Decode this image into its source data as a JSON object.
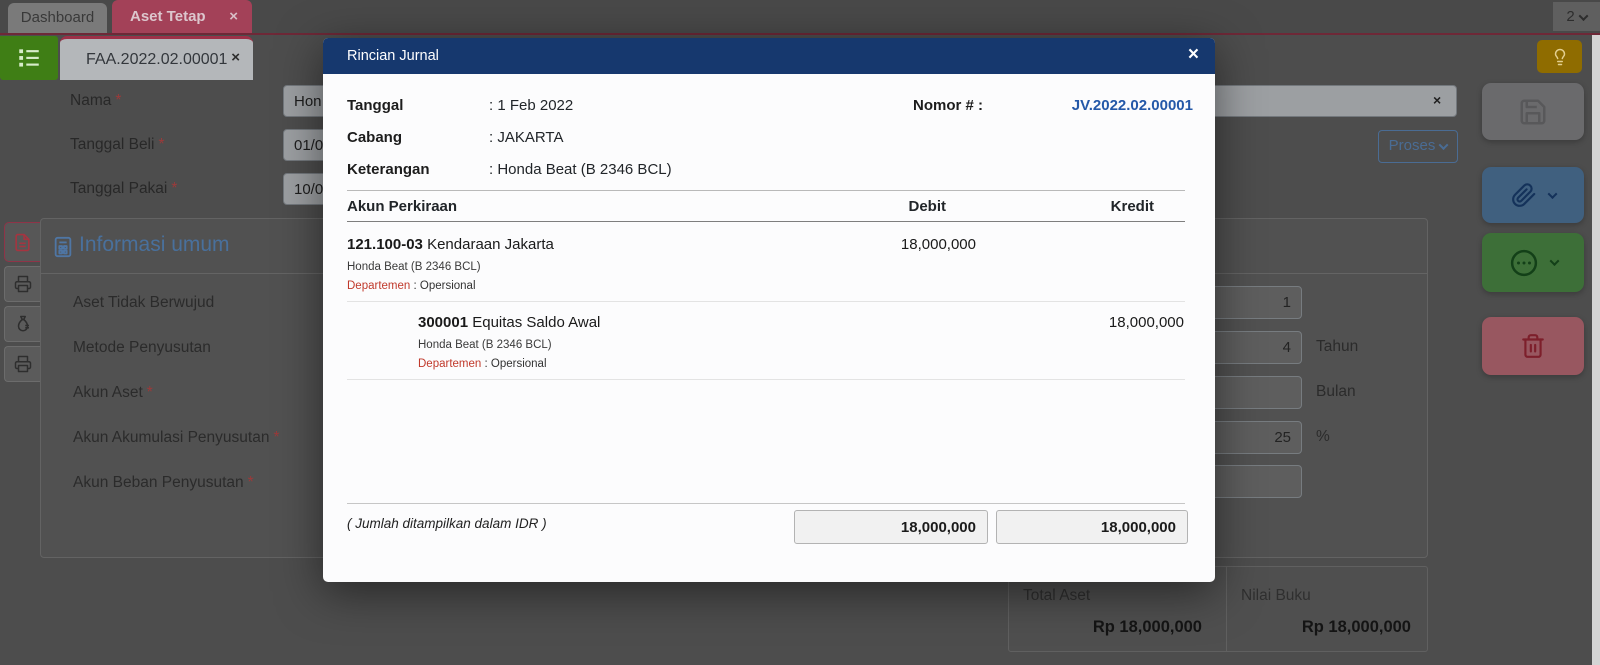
{
  "colors": {
    "modal_header_blue": "#16386E",
    "link_blue": "#2458A8",
    "departemen_red": "#C0392B",
    "active_tab_red": "#A34158",
    "menu_green": "#3F7E15",
    "hint_amber": "#8F6C00"
  },
  "top_bar": {
    "dashboard_tab": "Dashboard",
    "aset_tetap_tab": "Aset Tetap",
    "close_glyph": "×",
    "more_tabs_count": "2"
  },
  "doc_tab": {
    "label": "FAA.2022.02.00001",
    "close_glyph": "×"
  },
  "form": {
    "required_mark": "*",
    "rows": [
      {
        "label": "Nama",
        "value": "Hon"
      },
      {
        "label": "Tanggal Beli",
        "value": "01/0"
      },
      {
        "label": "Tanggal Pakai",
        "value": "10/0"
      }
    ],
    "clear_glyph": "×",
    "proses_button": "Proses",
    "panel": {
      "title": "Informasi umum",
      "fields": [
        {
          "label": "Aset Tidak Berwujud",
          "required": ""
        },
        {
          "label": "Metode Penyusutan",
          "required": ""
        },
        {
          "label": "Akun Aset",
          "required": "*"
        },
        {
          "label": "Akun Akumulasi Penyusutan",
          "required": "*"
        },
        {
          "label": "Akun Beban Penyusutan",
          "required": "*"
        }
      ],
      "right_inputs": [
        {
          "value": "1",
          "unit": ""
        },
        {
          "value": "4",
          "unit": "Tahun"
        },
        {
          "value": "",
          "unit": "Bulan"
        },
        {
          "value": "25",
          "unit": "%"
        },
        {
          "value": "",
          "unit": ""
        }
      ]
    },
    "summary": {
      "total_aset_label": "Total Aset",
      "total_aset_value": "Rp 18,000,000",
      "nilai_buku_label": "Nilai Buku",
      "nilai_buku_value": "Rp 18,000,000"
    }
  },
  "modal": {
    "title": "Rincian Jurnal",
    "close_glyph": "×",
    "info": {
      "tanggal_label": "Tanggal",
      "tanggal_value": ": 1 Feb 2022",
      "cabang_label": "Cabang",
      "cabang_value": ": JAKARTA",
      "keterangan_label": "Keterangan",
      "keterangan_value": ": Honda Beat (B 2346 BCL)",
      "nomor_label": "Nomor # :",
      "nomor_value": "JV.2022.02.00001"
    },
    "table": {
      "col_account": "Akun Perkiraan",
      "col_debit": "Debit",
      "col_kredit": "Kredit",
      "rows": [
        {
          "code": "121.100-03",
          "name": " Kendaraan Jakarta",
          "memo": "Honda Beat (B 2346 BCL)",
          "dept_label": "Departemen",
          "dept_value": " : Opersional",
          "debit": "18,000,000",
          "kredit": ""
        },
        {
          "code": "300001",
          "name": " Equitas Saldo Awal",
          "memo": "Honda Beat (B 2346 BCL)",
          "dept_label": "Departemen",
          "dept_value": " : Opersional",
          "debit": "",
          "kredit": "18,000,000"
        }
      ]
    },
    "footer": {
      "note": "( Jumlah ditampilkan dalam IDR )",
      "total_debit": "18,000,000",
      "total_kredit": "18,000,000"
    }
  }
}
